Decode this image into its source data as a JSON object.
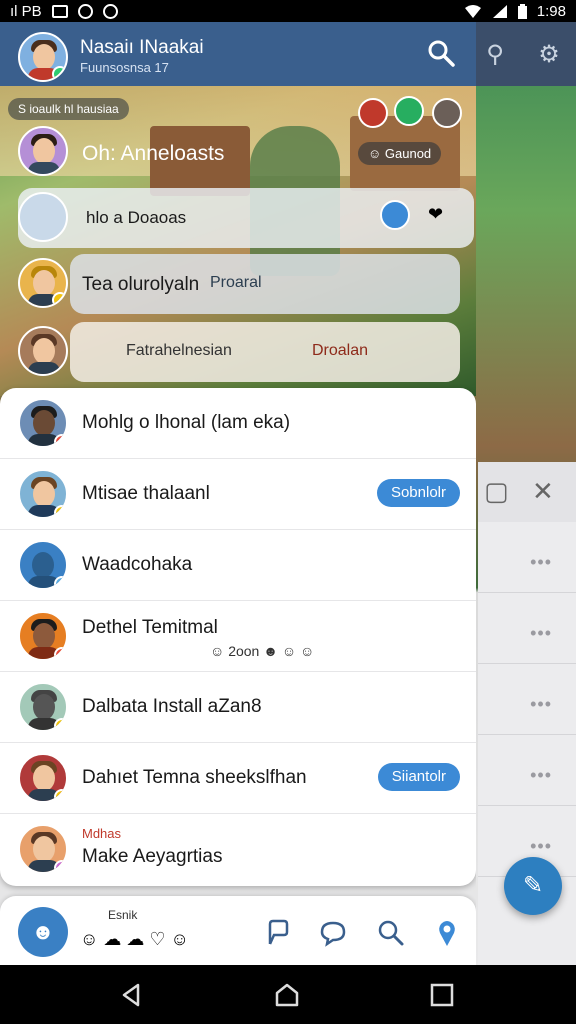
{
  "status_bar": {
    "left_text": "ıl PB",
    "time": "1:98"
  },
  "header": {
    "name": "Nasaiı INaakai",
    "subtitle": "Fuunsosnsa 17"
  },
  "scene": {
    "tag": "S ioaulk hl hausiaa",
    "row1_text": "Oh: Anneloasts",
    "row1_button": "Gaunod",
    "row2_text": "hlo a Doaoas",
    "row3_text": "Tea olurolyaln",
    "row3_badge": "Proaral",
    "row4_text": "Fatrahelnesian",
    "row4_badge": "Droalan"
  },
  "list": [
    {
      "label": "Mohlg o lhonal (lam eka)"
    },
    {
      "label": "Mtisae thalaanl",
      "action": "Sobnlolr"
    },
    {
      "label": "Waadcohaka"
    },
    {
      "label": "Dethel Temitmal",
      "emojis": "2oon"
    },
    {
      "label": "Dalbata Install aZan8"
    },
    {
      "label": "Dahıet Temna sheekslfhan",
      "action": "Siiantolr"
    },
    {
      "small": "Mdhas",
      "label": "Make Aeyagrtias"
    }
  ],
  "bottom": {
    "status": "Esnik"
  },
  "colors": {
    "header": "#3a5f8d",
    "accent": "#3c8ad6",
    "fab": "#2d7fc0"
  }
}
